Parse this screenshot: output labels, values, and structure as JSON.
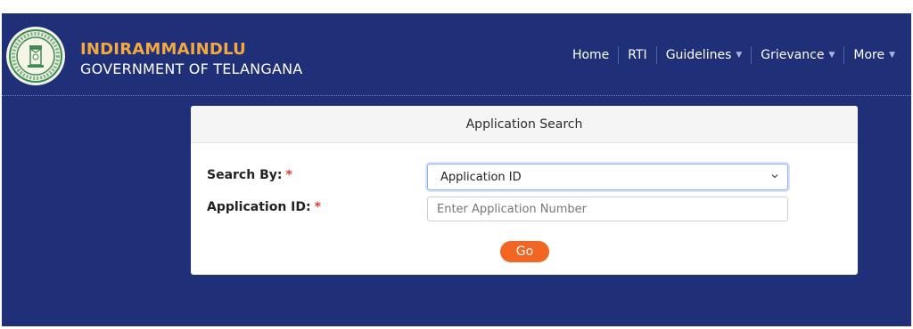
{
  "header": {
    "title": "INDIRAMMAINDLU",
    "subtitle": "GOVERNMENT OF TELANGANA",
    "logo_icon": "telangana-government-emblem",
    "title_color": "#f2a93f",
    "background_color": "#1f2f78"
  },
  "nav": {
    "items": [
      {
        "label": "Home",
        "dropdown": false
      },
      {
        "label": "RTI",
        "dropdown": false
      },
      {
        "label": "Guidelines",
        "dropdown": true
      },
      {
        "label": "Grievance",
        "dropdown": true
      },
      {
        "label": "More",
        "dropdown": true
      }
    ],
    "caret_icon": "caret-down-icon"
  },
  "card": {
    "title": "Application Search",
    "search_by_label": "Search By:",
    "application_id_label": "Application ID:",
    "required_mark": "*",
    "search_by_selected": "Application ID",
    "application_id_value": "",
    "application_id_placeholder": "Enter Application Number",
    "go_label": "Go",
    "go_color": "#f26522",
    "required_color": "#e53935"
  }
}
